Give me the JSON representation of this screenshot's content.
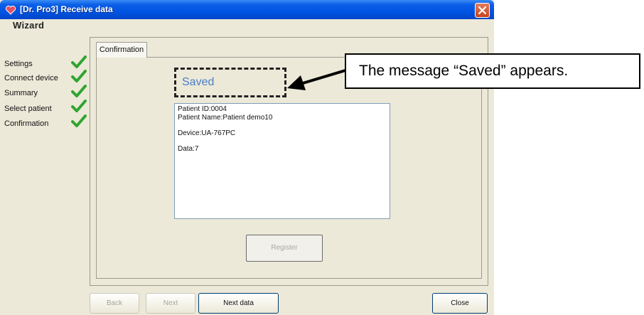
{
  "window": {
    "title": "[Dr. Pro3] Receive data",
    "icon": "heart-icon"
  },
  "wizard": {
    "title": "Wizard",
    "steps": [
      {
        "label": "Settings",
        "done": true
      },
      {
        "label": "Connect device",
        "done": true
      },
      {
        "label": "Summary",
        "done": true
      },
      {
        "label": "Select patient",
        "done": true
      },
      {
        "label": "Confirmation",
        "done": true
      }
    ]
  },
  "tab": {
    "label": "Confirmation"
  },
  "status": {
    "saved": "Saved"
  },
  "details": {
    "patient_id": "Patient ID:0004",
    "patient_name": "Patient Name:Patient demo10",
    "device": "Device:UA-767PC",
    "data": "Data:7"
  },
  "buttons": {
    "register": "Register",
    "back": "Back",
    "next": "Next",
    "next_data": "Next data",
    "close": "Close"
  },
  "annotation": {
    "callout": "The message “Saved” appears."
  },
  "colors": {
    "title_bar": "#0054e3",
    "saved_text": "#4a7ec9",
    "check": "#2fa52f"
  }
}
